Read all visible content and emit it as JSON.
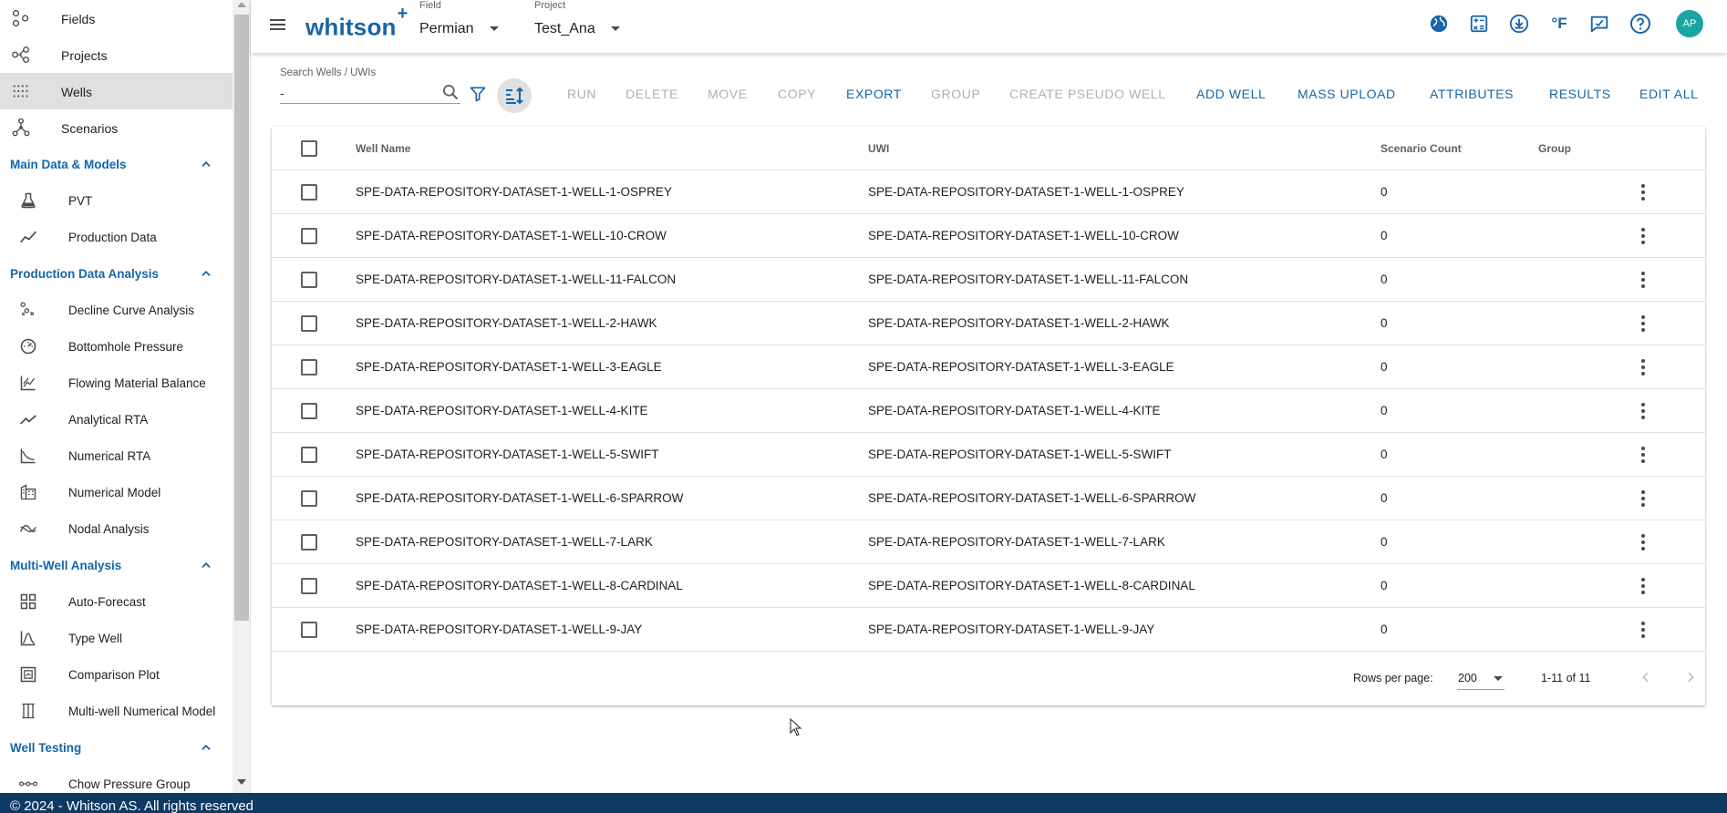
{
  "sidebar": {
    "top_items": [
      {
        "label": "Fields",
        "icon": "fields-icon"
      },
      {
        "label": "Projects",
        "icon": "projects-icon"
      },
      {
        "label": "Wells",
        "icon": "wells-icon",
        "active": true
      },
      {
        "label": "Scenarios",
        "icon": "scenarios-icon"
      }
    ],
    "sections": [
      {
        "title": "Main Data & Models",
        "items": [
          {
            "label": "PVT",
            "icon": "flask-icon"
          },
          {
            "label": "Production Data",
            "icon": "line-chart-icon"
          }
        ]
      },
      {
        "title": "Production Data Analysis",
        "items": [
          {
            "label": "Decline Curve Analysis",
            "icon": "decline-curve-icon"
          },
          {
            "label": "Bottomhole Pressure",
            "icon": "gauge-icon"
          },
          {
            "label": "Flowing Material Balance",
            "icon": "material-balance-icon"
          },
          {
            "label": "Analytical RTA",
            "icon": "trend-icon"
          },
          {
            "label": "Numerical RTA",
            "icon": "numerical-rta-icon"
          },
          {
            "label": "Numerical Model",
            "icon": "grid-model-icon"
          },
          {
            "label": "Nodal Analysis",
            "icon": "nodal-icon"
          }
        ]
      },
      {
        "title": "Multi-Well Analysis",
        "items": [
          {
            "label": "Auto-Forecast",
            "icon": "dashboard-icon"
          },
          {
            "label": "Type Well",
            "icon": "bell-curve-icon"
          },
          {
            "label": "Comparison Plot",
            "icon": "comparison-icon"
          },
          {
            "label": "Multi-well Numerical Model",
            "icon": "columns-icon"
          }
        ]
      },
      {
        "title": "Well Testing",
        "items": [
          {
            "label": "Chow Pressure Group",
            "icon": "chain-icon"
          }
        ]
      }
    ]
  },
  "header": {
    "logo_text": "whitson",
    "logo_plus": "+",
    "field_caption": "Field",
    "field_value": "Permian",
    "project_caption": "Project",
    "project_value": "Test_Ana",
    "icons": [
      "globe-icon",
      "calculator-icon",
      "download-icon",
      "fahrenheit-icon",
      "feedback-icon",
      "help-icon"
    ],
    "unit_label": "°F",
    "avatar_initials": "AP"
  },
  "toolbar": {
    "search_label": "Search Wells / UWIs",
    "search_value": "-",
    "buttons": [
      {
        "label": "RUN",
        "enabled": false
      },
      {
        "label": "DELETE",
        "enabled": false
      },
      {
        "label": "MOVE",
        "enabled": false
      },
      {
        "label": "COPY",
        "enabled": false
      },
      {
        "label": "EXPORT",
        "enabled": true
      },
      {
        "label": "GROUP",
        "enabled": false
      },
      {
        "label": "CREATE PSEUDO WELL",
        "enabled": false
      },
      {
        "label": "ADD WELL",
        "enabled": true
      },
      {
        "label": "MASS UPLOAD",
        "enabled": true
      },
      {
        "label": "ATTRIBUTES",
        "enabled": true
      },
      {
        "label": "RESULTS",
        "enabled": true
      },
      {
        "label": "EDIT ALL",
        "enabled": true
      }
    ]
  },
  "table": {
    "columns": [
      "Well Name",
      "UWI",
      "Scenario Count",
      "Group"
    ],
    "rows": [
      {
        "name": "SPE-DATA-REPOSITORY-DATASET-1-WELL-1-OSPREY",
        "uwi": "SPE-DATA-REPOSITORY-DATASET-1-WELL-1-OSPREY",
        "count": "0",
        "group": ""
      },
      {
        "name": "SPE-DATA-REPOSITORY-DATASET-1-WELL-10-CROW",
        "uwi": "SPE-DATA-REPOSITORY-DATASET-1-WELL-10-CROW",
        "count": "0",
        "group": ""
      },
      {
        "name": "SPE-DATA-REPOSITORY-DATASET-1-WELL-11-FALCON",
        "uwi": "SPE-DATA-REPOSITORY-DATASET-1-WELL-11-FALCON",
        "count": "0",
        "group": ""
      },
      {
        "name": "SPE-DATA-REPOSITORY-DATASET-1-WELL-2-HAWK",
        "uwi": "SPE-DATA-REPOSITORY-DATASET-1-WELL-2-HAWK",
        "count": "0",
        "group": ""
      },
      {
        "name": "SPE-DATA-REPOSITORY-DATASET-1-WELL-3-EAGLE",
        "uwi": "SPE-DATA-REPOSITORY-DATASET-1-WELL-3-EAGLE",
        "count": "0",
        "group": ""
      },
      {
        "name": "SPE-DATA-REPOSITORY-DATASET-1-WELL-4-KITE",
        "uwi": "SPE-DATA-REPOSITORY-DATASET-1-WELL-4-KITE",
        "count": "0",
        "group": ""
      },
      {
        "name": "SPE-DATA-REPOSITORY-DATASET-1-WELL-5-SWIFT",
        "uwi": "SPE-DATA-REPOSITORY-DATASET-1-WELL-5-SWIFT",
        "count": "0",
        "group": ""
      },
      {
        "name": "SPE-DATA-REPOSITORY-DATASET-1-WELL-6-SPARROW",
        "uwi": "SPE-DATA-REPOSITORY-DATASET-1-WELL-6-SPARROW",
        "count": "0",
        "group": ""
      },
      {
        "name": "SPE-DATA-REPOSITORY-DATASET-1-WELL-7-LARK",
        "uwi": "SPE-DATA-REPOSITORY-DATASET-1-WELL-7-LARK",
        "count": "0",
        "group": ""
      },
      {
        "name": "SPE-DATA-REPOSITORY-DATASET-1-WELL-8-CARDINAL",
        "uwi": "SPE-DATA-REPOSITORY-DATASET-1-WELL-8-CARDINAL",
        "count": "0",
        "group": ""
      },
      {
        "name": "SPE-DATA-REPOSITORY-DATASET-1-WELL-9-JAY",
        "uwi": "SPE-DATA-REPOSITORY-DATASET-1-WELL-9-JAY",
        "count": "0",
        "group": ""
      }
    ]
  },
  "pagination": {
    "rows_per_page_label": "Rows per page:",
    "rows_per_page_value": "200",
    "range": "1-11 of 11"
  },
  "footer": {
    "text": "© 2024 - Whitson AS. All rights reserved"
  },
  "colors": {
    "accent": "#1565a8",
    "footer_bg": "#0e3a63",
    "avatar": "#1aa4a4",
    "disabled": "#b0b0b0",
    "active_row": "#e0e0e0"
  }
}
